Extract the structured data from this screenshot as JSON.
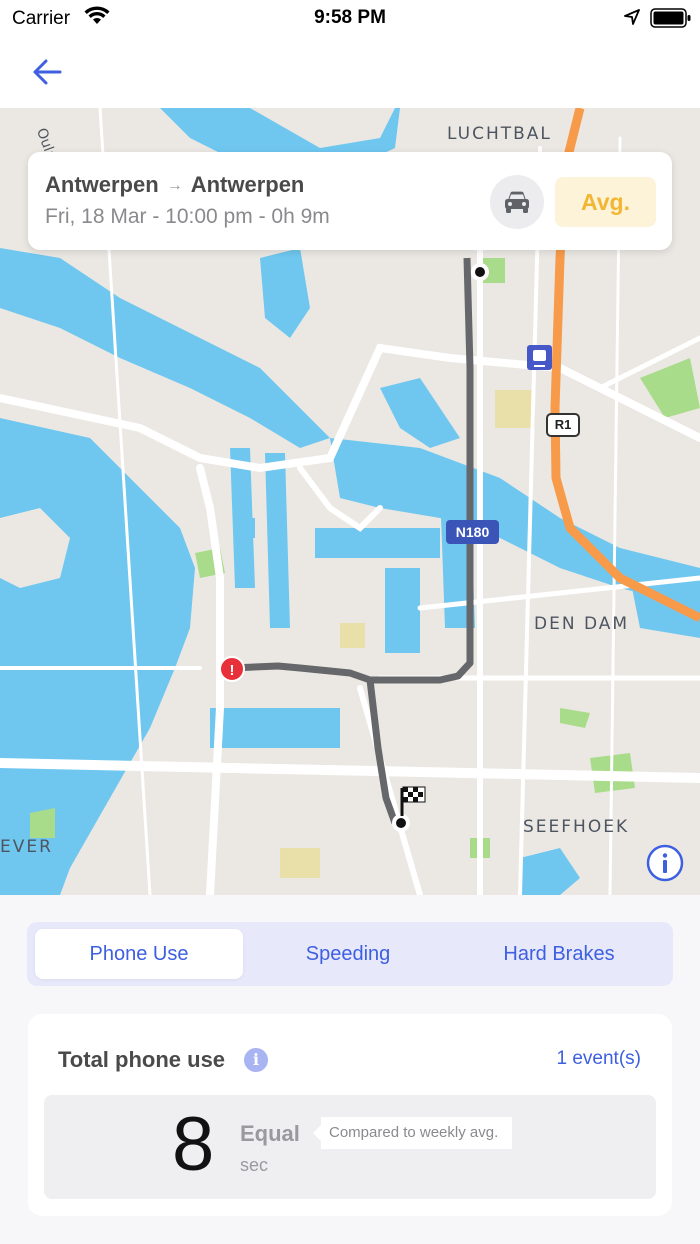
{
  "status_bar": {
    "carrier": "Carrier",
    "time": "9:58 PM"
  },
  "map": {
    "labels": {
      "luchtbal": "LUCHTBAL",
      "den_dam": "DEN DAM",
      "seefhoek": "SEEFHOEK",
      "ever": "EVER",
      "oulan": "Oulan",
      "r1": "R1",
      "n180": "N180"
    },
    "colors": {
      "water": "#6fc7ef",
      "route": "#66676b",
      "highway": "#f79a4a"
    }
  },
  "trip": {
    "origin": "Antwerpen",
    "arrow": "→",
    "destination": "Antwerpen",
    "details": "Fri, 18 Mar - 10:00 pm - 0h 9m",
    "score": "Avg."
  },
  "tabs": [
    {
      "label": "Phone Use",
      "active": true
    },
    {
      "label": "Speeding",
      "active": false
    },
    {
      "label": "Hard Brakes",
      "active": false
    }
  ],
  "summary": {
    "title": "Total phone use",
    "info_icon": "i",
    "event_count": "1 event(s)",
    "value": "8",
    "comparison": "Equal",
    "unit": "sec",
    "tooltip": "Compared to weekly avg."
  },
  "colors": {
    "accent": "#3d5fe0",
    "score_text": "#f2b632",
    "score_bg": "#fdf3d9"
  }
}
